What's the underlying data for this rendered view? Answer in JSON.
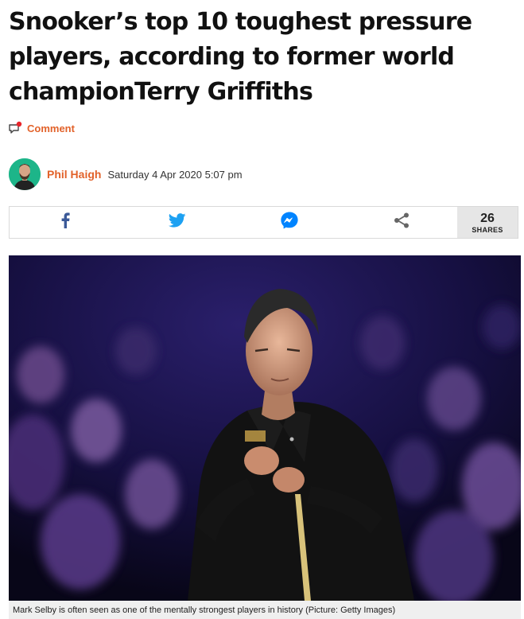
{
  "article": {
    "headline": "Snooker’s top 10 toughest pressure players, according to former world championTerry Griffiths",
    "comment_label": "Comment",
    "author": "Phil Haigh",
    "date": "Saturday 4 Apr 2020 5:07 pm"
  },
  "share": {
    "buttons": [
      "facebook-icon",
      "twitter-icon",
      "messenger-icon",
      "share-icon"
    ],
    "count": "26",
    "count_label": "SHARES"
  },
  "image": {
    "caption": "Mark Selby is often seen as one of the mentally strongest players in history (Picture: Getty Images)"
  },
  "colors": {
    "accent": "#e2622a",
    "facebook": "#3b5998",
    "twitter": "#1da1f2",
    "messenger": "#0084ff",
    "avatar_bg": "#1db589"
  }
}
